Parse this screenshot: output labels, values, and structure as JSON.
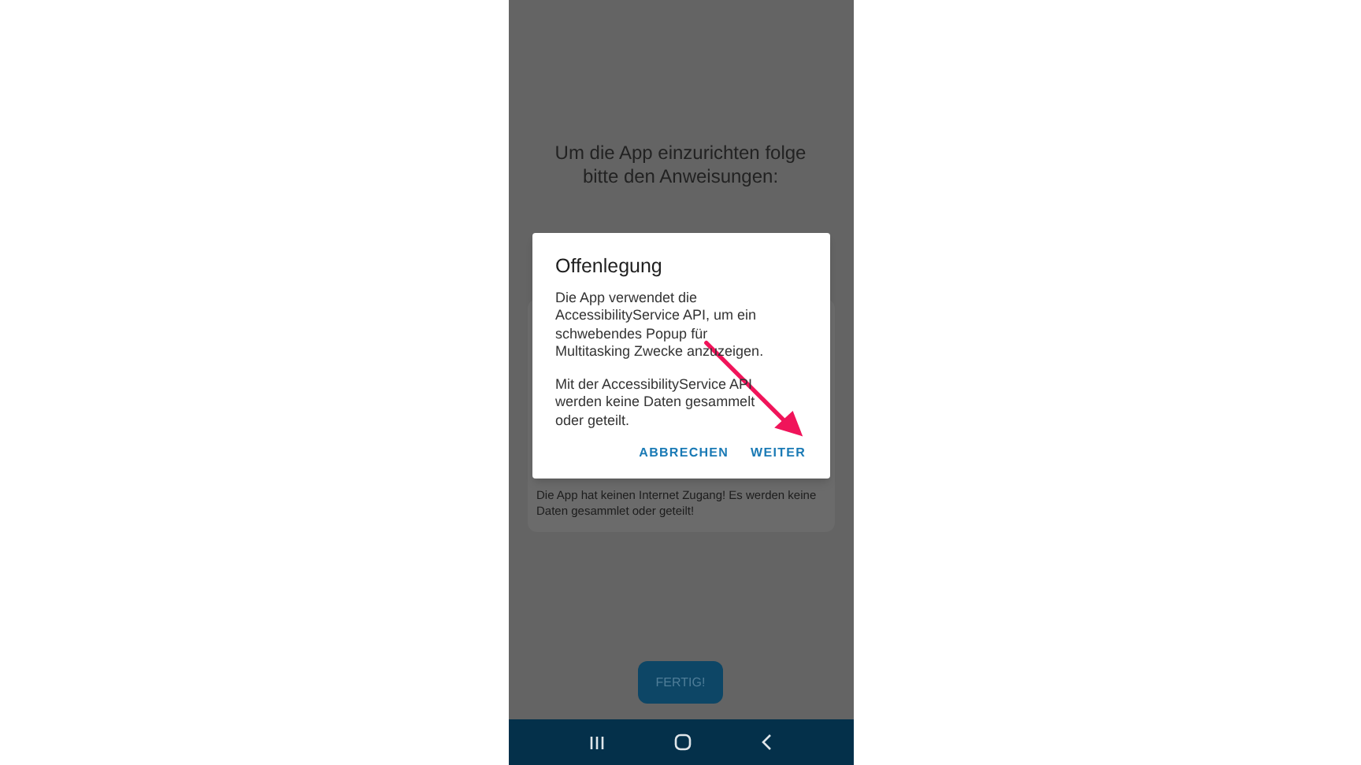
{
  "screen": {
    "heading": "Um die App einzurichten folge bitte den Anweisungen:",
    "card_note": "Die App hat keinen Internet Zugang! Es werden keine Daten gesammlet oder geteilt!",
    "done_button": "FERTIG!"
  },
  "dialog": {
    "title": "Offenlegung",
    "paragraphs": [
      "Die App verwendet die AccessibilityService API, um ein schwebendes Popup für Multitasking Zwecke anzuzeigen.",
      "Mit der AccessibilityService API werden keine Daten gesammelt oder geteilt."
    ],
    "buttons": [
      "ABBRECHEN",
      "WEITER"
    ]
  }
}
